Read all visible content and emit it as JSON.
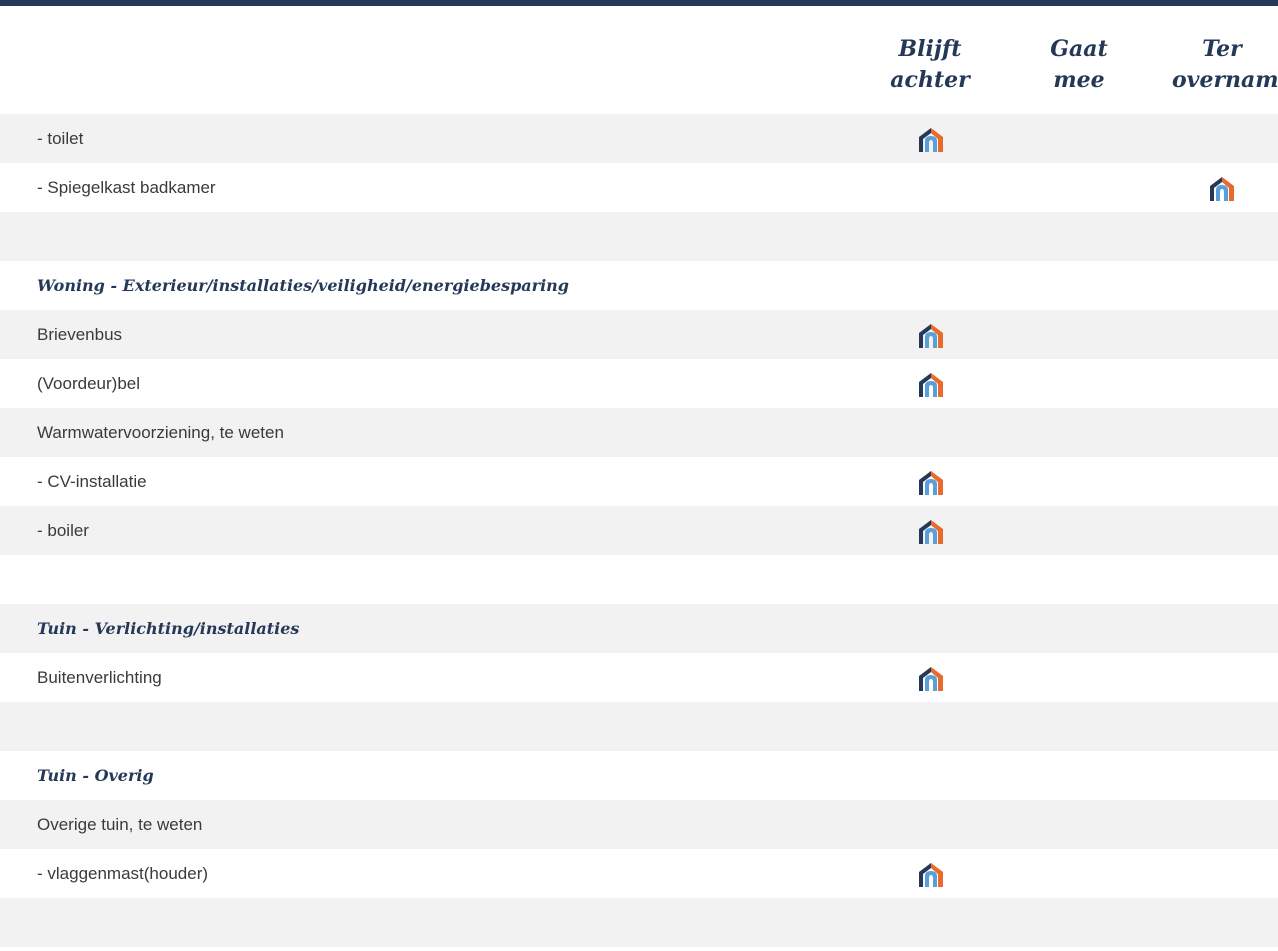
{
  "columns": {
    "blijft_achter_line1": "Blijft",
    "blijft_achter_line2": "achter",
    "gaat_mee_line1": "Gaat",
    "gaat_mee_line2": "mee",
    "ter_overname_line1": "Ter",
    "ter_overname_line2": "overname"
  },
  "icon": {
    "name": "house-logo-icon",
    "color_dark": "#253858",
    "color_light": "#5a9fd8",
    "color_orange": "#e86a2c"
  },
  "rows": [
    {
      "label": "- toilet",
      "type": "item",
      "choice": "blijft_achter"
    },
    {
      "label": "- Spiegelkast badkamer",
      "type": "item",
      "choice": "ter_overname"
    },
    {
      "label": "",
      "type": "spacer",
      "choice": ""
    },
    {
      "label": "Woning - Exterieur/installaties/veiligheid/energiebesparing",
      "type": "section",
      "choice": ""
    },
    {
      "label": "Brievenbus",
      "type": "item",
      "choice": "blijft_achter"
    },
    {
      "label": "(Voordeur)bel",
      "type": "item",
      "choice": "blijft_achter"
    },
    {
      "label": "Warmwatervoorziening, te weten",
      "type": "item",
      "choice": ""
    },
    {
      "label": "- CV-installatie",
      "type": "item",
      "choice": "blijft_achter"
    },
    {
      "label": "- boiler",
      "type": "item",
      "choice": "blijft_achter"
    },
    {
      "label": "",
      "type": "spacer",
      "choice": ""
    },
    {
      "label": "Tuin - Verlichting/installaties",
      "type": "section",
      "choice": ""
    },
    {
      "label": "Buitenverlichting",
      "type": "item",
      "choice": "blijft_achter"
    },
    {
      "label": "",
      "type": "spacer",
      "choice": ""
    },
    {
      "label": "Tuin - Overig",
      "type": "section",
      "choice": ""
    },
    {
      "label": "Overige tuin, te weten",
      "type": "item",
      "choice": ""
    },
    {
      "label": "- vlaggenmast(houder)",
      "type": "item",
      "choice": "blijft_achter"
    },
    {
      "label": "",
      "type": "spacer",
      "choice": ""
    }
  ]
}
